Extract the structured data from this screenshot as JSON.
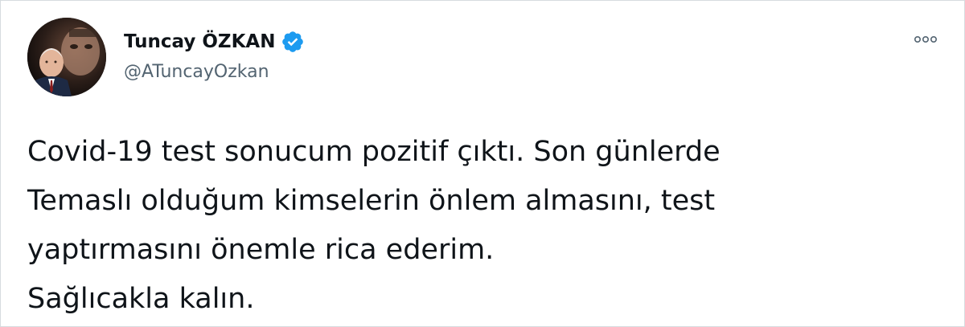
{
  "tweet": {
    "author": {
      "display_name": "Tuncay ÖZKAN",
      "handle": "@ATuncayOzkan",
      "verified": true,
      "verified_icon": "verified-badge-icon",
      "avatar": "profile-photo"
    },
    "more_icon": "more-options-icon",
    "text_lines": [
      "Covid-19 test sonucum pozitif çıktı. Son günlerde",
      "Temaslı olduğum kimselerin önlem almasını, test",
      "yaptırmasını önemle rica ederim.",
      "Sağlıcakla kalın."
    ]
  },
  "colors": {
    "verified_blue": "#1d9bf0",
    "handle_gray": "#536471",
    "text": "#0f1419"
  }
}
